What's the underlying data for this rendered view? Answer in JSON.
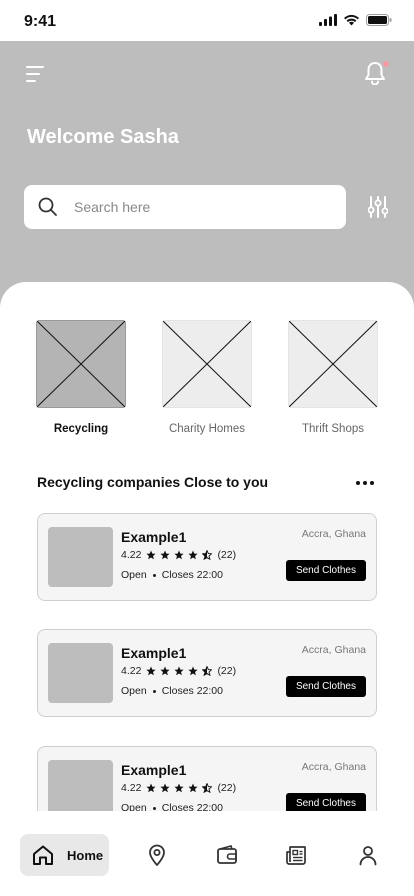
{
  "status": {
    "time": "9:41"
  },
  "header": {
    "welcome": "Welcome Sasha"
  },
  "search": {
    "placeholder": "Search here"
  },
  "categories": [
    {
      "label": "Recycling",
      "active": true
    },
    {
      "label": "Charity Homes",
      "active": false
    },
    {
      "label": "Thrift Shops",
      "active": false
    }
  ],
  "section": {
    "title": "Recycling companies Close to you"
  },
  "companies": [
    {
      "name": "Example1",
      "rating": "4.22",
      "stars": 4.5,
      "reviews": "(22)",
      "status": "Open",
      "closes": "Closes 22:00",
      "location": "Accra, Ghana",
      "action": "Send Clothes"
    },
    {
      "name": "Example1",
      "rating": "4.22",
      "stars": 4.5,
      "reviews": "(22)",
      "status": "Open",
      "closes": "Closes 22:00",
      "location": "Accra, Ghana",
      "action": "Send Clothes"
    },
    {
      "name": "Example1",
      "rating": "4.22",
      "stars": 4.5,
      "reviews": "(22)",
      "status": "Open",
      "closes": "Closes 22:00",
      "location": "Accra, Ghana",
      "action": "Send Clothes"
    }
  ],
  "nav": {
    "home_label": "Home"
  },
  "colors": {
    "header_bg": "#bdbdbd",
    "accent": "#000000",
    "notification_dot": "#f39ca5"
  }
}
